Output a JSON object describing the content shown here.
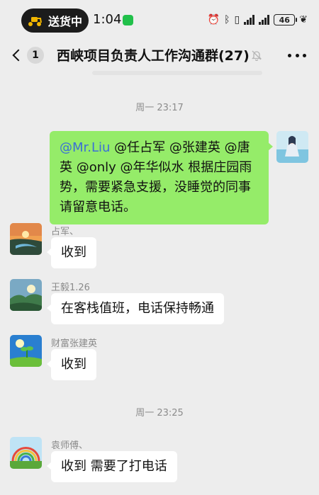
{
  "status_bar": {
    "delivery_label": "送货中",
    "time": "1:04",
    "battery": "46",
    "icons": [
      "alarm-icon",
      "bluetooth-icon",
      "vibrate-icon",
      "signal-icon",
      "signal-icon",
      "battery-icon",
      "leaf-icon"
    ]
  },
  "nav": {
    "unread_count": "1",
    "title": "西峡项目负责人工作沟通群(27)",
    "mute_icon": "bell-off-icon",
    "more_icon": "more-dots-icon"
  },
  "timestamps": [
    "周一 23:17",
    "周一 23:25"
  ],
  "my_message": {
    "mention_colored": "Mr.Liu",
    "text_rest": " @任占军 @张建英 @唐英 @only @年华似水  根据庄园雨势，需要紧急支援，没睡觉的同事请留意电话。",
    "at_prefix": "@"
  },
  "messages": [
    {
      "sender": "占军、",
      "text": "收到"
    },
    {
      "sender": "王毅1.26",
      "text": "在客栈值班，电话保持畅通"
    },
    {
      "sender": "财富张建英",
      "text": "收到"
    },
    {
      "sender": "袁师傅、",
      "text": "收到  需要了打电话"
    }
  ],
  "colors": {
    "background": "#ededed",
    "my_bubble": "#95ec69",
    "their_bubble": "#ffffff",
    "mention": "#3b6fd6"
  }
}
